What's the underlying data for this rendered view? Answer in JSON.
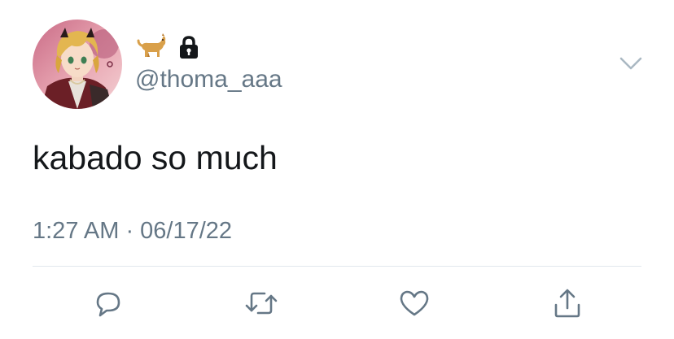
{
  "user": {
    "display_emoji": "🐕",
    "locked_icon": "lock-icon",
    "handle": "@thoma_aaa",
    "avatar_icon": "avatar"
  },
  "tweet": {
    "text": "kabado so much",
    "timestamp": "1:27 AM · 06/17/22"
  },
  "menu_icon": "chevron-down-icon",
  "actions": [
    {
      "icon": "reply-icon"
    },
    {
      "icon": "retweet-icon"
    },
    {
      "icon": "like-icon"
    },
    {
      "icon": "share-icon"
    }
  ],
  "colors": {
    "text_primary": "#14171a",
    "text_secondary": "#657786",
    "divider": "#e1e8ed"
  }
}
